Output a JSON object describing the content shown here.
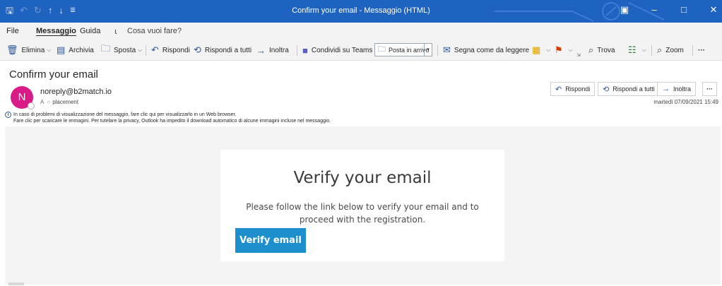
{
  "window": {
    "title": "Confirm your email  -  Messaggio (HTML)",
    "qat_icons": [
      "save-icon",
      "undo-icon",
      "redo-icon",
      "up-arrow-icon",
      "down-arrow-icon",
      "customize-icon"
    ],
    "controls": [
      "ribbon-display-icon",
      "minimize-icon",
      "maximize-icon",
      "close-icon"
    ]
  },
  "ribbon_tabs": {
    "file": "File",
    "message": "Messaggio",
    "help": "Guida",
    "tell_me": "Cosa vuoi fare?"
  },
  "toolbar": {
    "delete": "Elimina",
    "archive": "Archivia",
    "move": "Sposta",
    "reply": "Rispondi",
    "reply_all": "Rispondi a tutti",
    "forward": "Inoltra",
    "teams": "Condividi su Teams",
    "folder": "Posta in arrivo",
    "mark_read": "Segna come da leggere",
    "find": "Trova",
    "zoom": "Zoom",
    "more": "···"
  },
  "message": {
    "subject": "Confirm your email",
    "avatar_initial": "N",
    "sender": "noreply@b2match.io",
    "to_label": "A",
    "recipient": "placement",
    "date": "martedì 07/09/2021 15:49",
    "actions": {
      "reply": "Rispondi",
      "reply_all": "Rispondi a tutti",
      "forward": "Inoltra",
      "more": "···"
    },
    "info_line1": "In caso di problemi di visualizzazione del messaggio, fare clic qui per visualizzarlo in un Web browser.",
    "info_line2": "Fare clic per scaricare le immagini. Per tutelare la privacy, Outlook ha impedito il download automatico di alcune immagini incluse nel messaggio."
  },
  "email": {
    "heading": "Verify your email",
    "body": "Please follow the link below to verify your email and to proceed with the registration.",
    "button": "Verify email"
  },
  "colors": {
    "titlebar": "#1f63c1",
    "avatar": "#d81b86",
    "button": "#1e8fcd"
  }
}
